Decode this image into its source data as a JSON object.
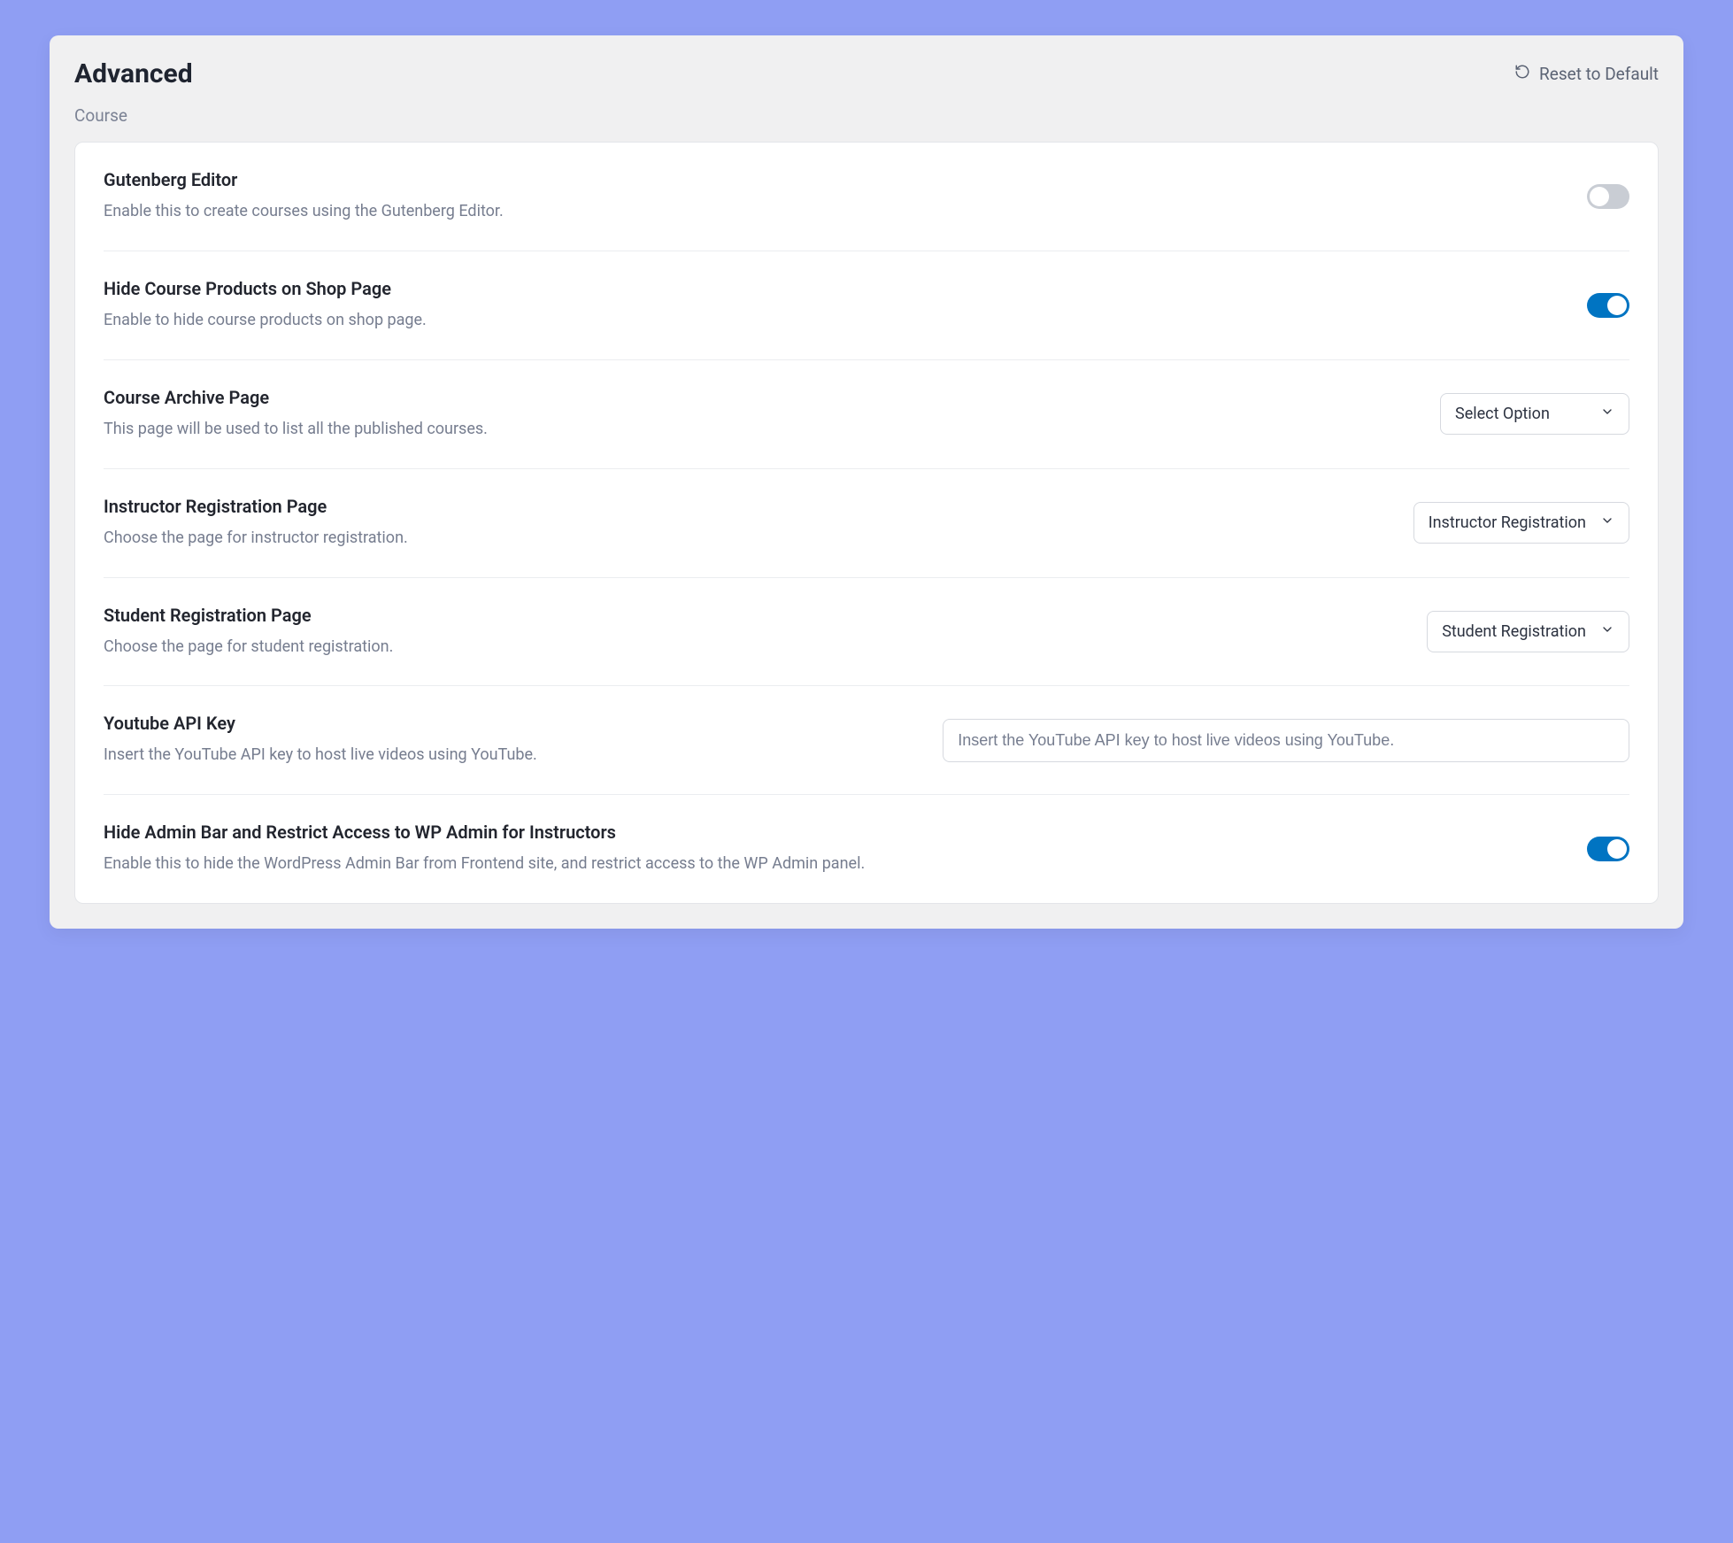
{
  "header": {
    "title": "Advanced",
    "reset_label": "Reset to Default"
  },
  "section_label": "Course",
  "colors": {
    "accent": "#0074c2"
  },
  "rows": {
    "gutenberg": {
      "title": "Gutenberg Editor",
      "desc": "Enable this to create courses using the Gutenberg Editor.",
      "toggle_on": false
    },
    "hide_products": {
      "title": "Hide Course Products on Shop Page",
      "desc": "Enable to hide course products on shop page.",
      "toggle_on": true
    },
    "archive_page": {
      "title": "Course Archive Page",
      "desc": "This page will be used to list all the published courses.",
      "select_value": "Select Option"
    },
    "instructor_page": {
      "title": "Instructor Registration Page",
      "desc": "Choose the page for instructor registration.",
      "select_value": "Instructor Registration"
    },
    "student_page": {
      "title": "Student Registration Page",
      "desc": "Choose the page for student registration.",
      "select_value": "Student Registration"
    },
    "youtube_api": {
      "title": "Youtube API Key",
      "desc": "Insert the YouTube API key to host live videos using YouTube.",
      "placeholder": "Insert the YouTube API key to host live videos using YouTube.",
      "value": ""
    },
    "hide_admin_bar": {
      "title": "Hide Admin Bar and Restrict Access to WP Admin for Instructors",
      "desc": "Enable this to hide the WordPress Admin Bar from Frontend site, and restrict access to the WP Admin panel.",
      "toggle_on": true
    }
  }
}
